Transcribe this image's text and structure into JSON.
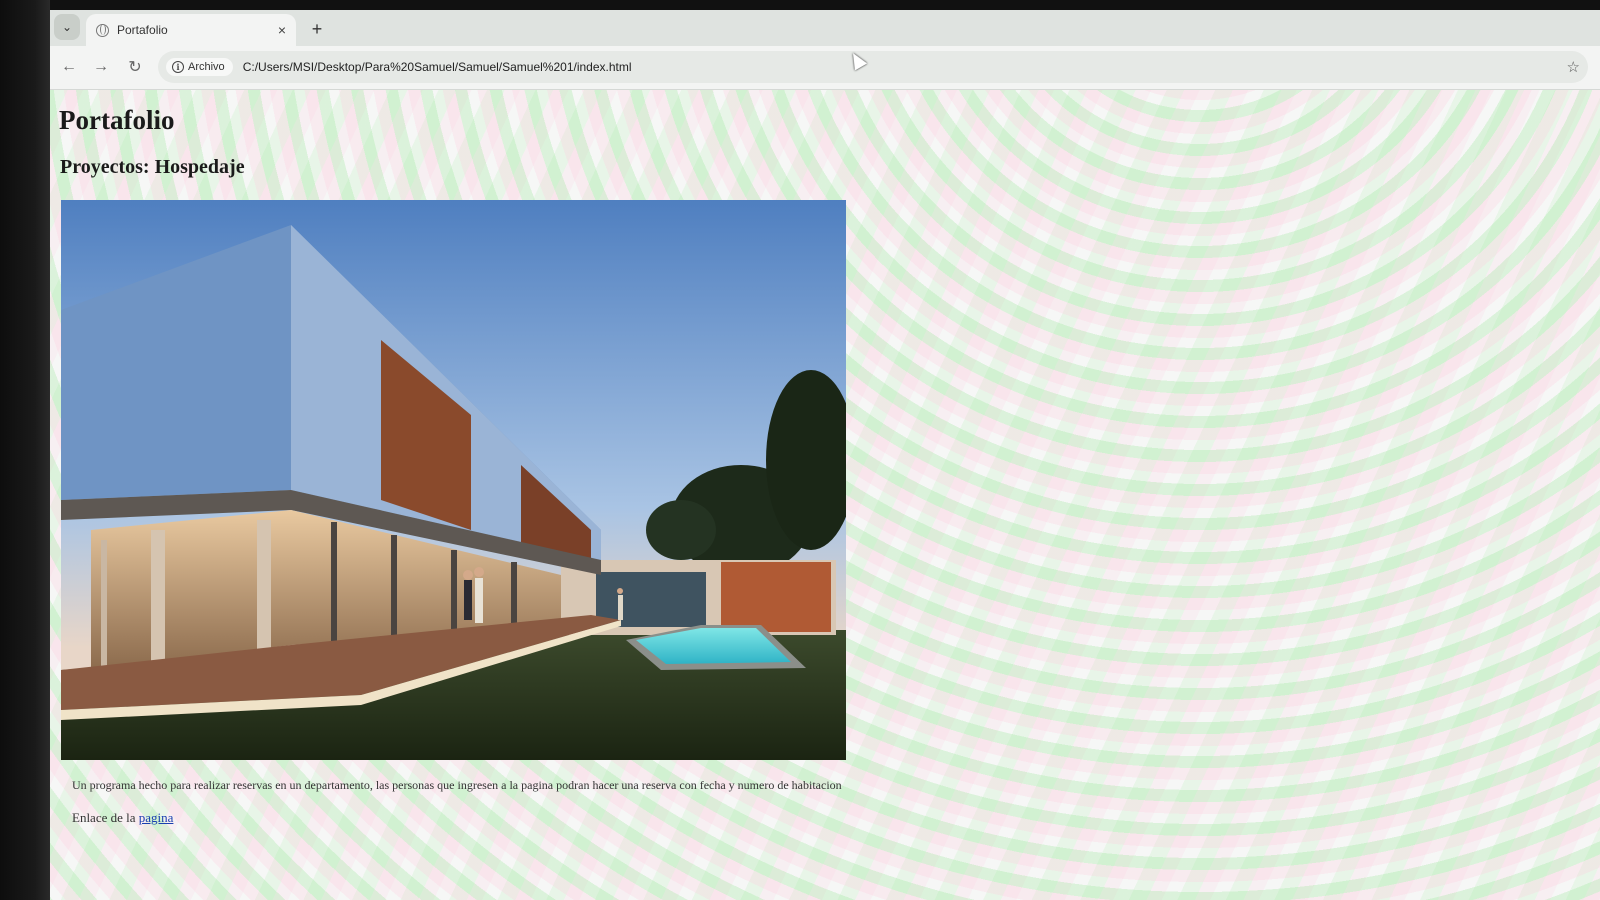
{
  "browser": {
    "tab_title": "Portafolio",
    "new_tab_label": "+",
    "tab_close_glyph": "×",
    "tab_list_glyph": "⌄",
    "security_label": "Archivo",
    "url": "C:/Users/MSI/Desktop/Para%20Samuel/Samuel/Samuel%201/index.html",
    "back_glyph": "←",
    "forward_glyph": "→",
    "reload_glyph": "↻",
    "star_glyph": "☆",
    "info_glyph": "i"
  },
  "page": {
    "title": "Portafolio",
    "section_title": "Proyectos: Hospedaje",
    "description": "Un programa hecho para realizar reservas en un departamento, las personas que ingresen a la pagina podran hacer una reserva con fecha y numero de habitacion",
    "link_prefix": "Enlace de la ",
    "link_text": "pagina"
  },
  "colors": {
    "link": "#1a3fb0",
    "text": "#1a1a1a"
  }
}
